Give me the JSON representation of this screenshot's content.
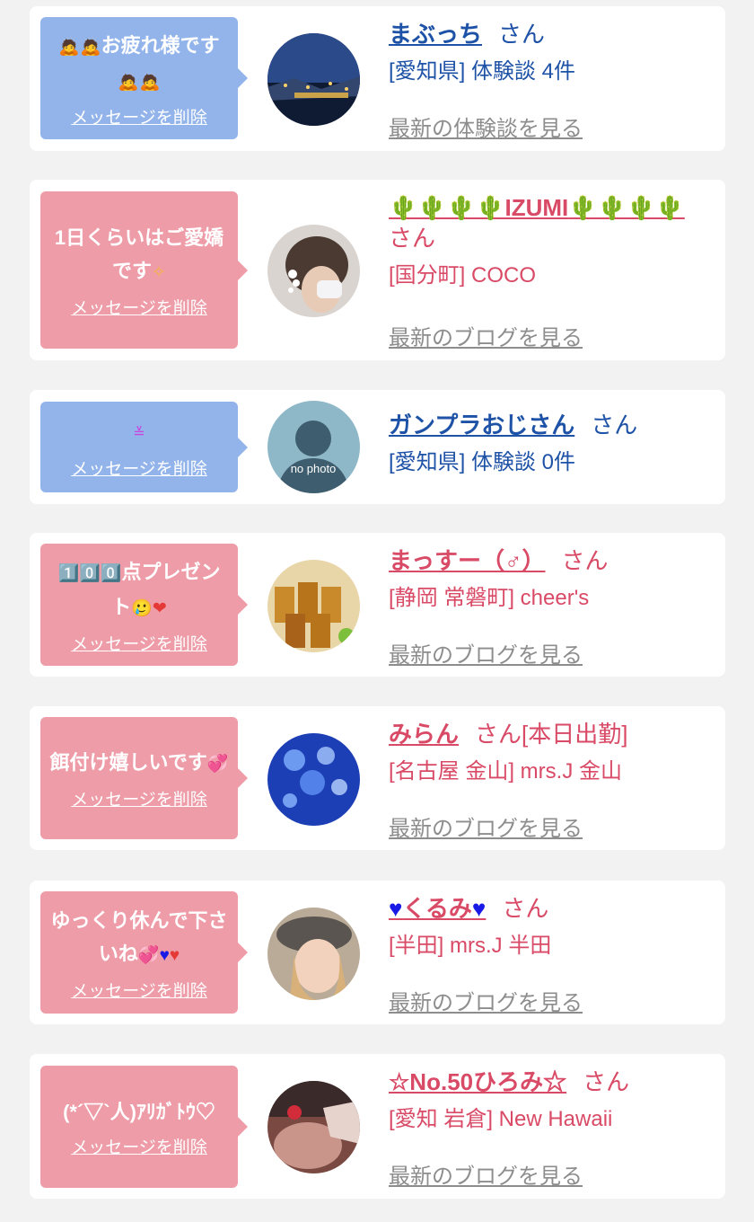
{
  "delete_label": "メッセージを削除",
  "san_label": "さん",
  "no_photo_label": "no photo",
  "cards": [
    {
      "message": "お疲れ様です",
      "name": "まぶっち",
      "suffix": "",
      "shop": "[愛知県] 体験談 4件",
      "latest": "最新の体験談を見る",
      "theme_color": "#1e52a6"
    },
    {
      "message": "1日くらいはご愛嬌です",
      "name": "IZUMI",
      "suffix": "",
      "shop": "[国分町] COCO",
      "latest": "最新のブログを見る",
      "theme_color": "#d94a66"
    },
    {
      "message": "",
      "name": "ガンプラおじさん",
      "suffix": "",
      "shop": "[愛知県] 体験談 0件",
      "latest": "",
      "theme_color": "#1e52a6"
    },
    {
      "message": "点プレゼント",
      "name": "まっすー（♂）",
      "suffix": "",
      "shop": "[静岡 常磐町] cheer's",
      "latest": "最新のブログを見る",
      "theme_color": "#d94a66"
    },
    {
      "message": "餌付け嬉しいです",
      "name": "みらん",
      "suffix": "[本日出勤]",
      "shop": "[名古屋 金山] mrs.J 金山",
      "latest": "最新のブログを見る",
      "theme_color": "#d94a66"
    },
    {
      "message": "ゆっくり休んで下さいね",
      "name": "くるみ",
      "suffix": "",
      "shop": "[半田] mrs.J 半田",
      "latest": "最新のブログを見る",
      "theme_color": "#d94a66"
    },
    {
      "message": "(*´▽`人)ｱﾘｶﾞﾄｳ♡",
      "name": "☆No.50ひろみ☆",
      "suffix": "",
      "shop": "[愛知 岩倉] New Hawaii",
      "latest": "最新のブログを見る",
      "theme_color": "#d94a66"
    }
  ]
}
